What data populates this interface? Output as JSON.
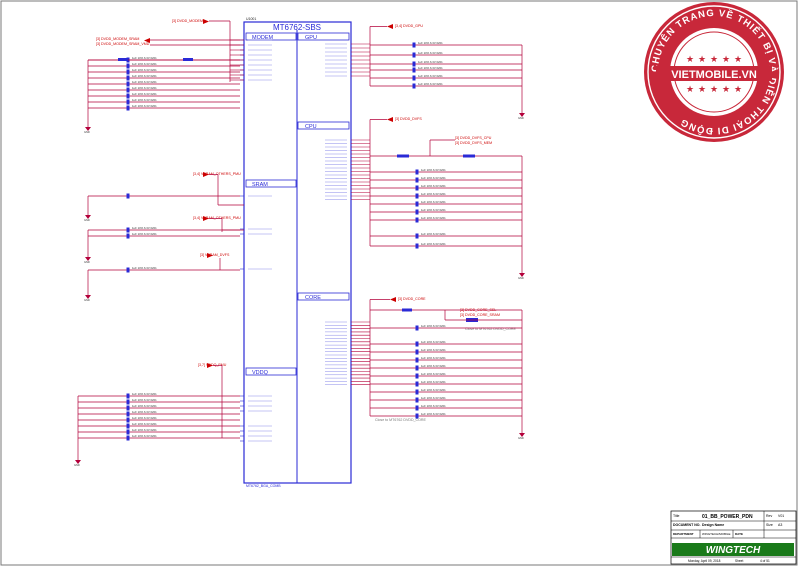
{
  "chip": {
    "title": "MT6762-SBS",
    "ref": "U1001",
    "footer": "MT6762_BGA_COMB",
    "sections": {
      "modem": "MODEM",
      "sram": "SRAM",
      "vddq": "VDDQ",
      "gpu": "GPU",
      "cpu": "CPU",
      "core": "CORE"
    }
  },
  "nets": {
    "modem_top": "[3] DVDD_MODEM",
    "modem_sub1": "[3] DVDD_MODEM_SRAM",
    "modem_sub2": "[3] DVDD_MODEM_SRAM_VMD",
    "sram": "[3,4] VSRAM_OTHERS_PMU",
    "sram_core": "[3,4] VSRAM_OTHERS_PMU",
    "sram_dvfs": "[3] VSRAM_DVFS",
    "vddq": "[3,7] VDDQ_PMU",
    "gpu": "[3,4] DVDD_GPU",
    "cpu": "[3] DVDD_DVFS",
    "core": "[3] DVDD_CORE",
    "core_sub1": "[3] DVDD_CORE_SEL",
    "core_sub2": "[3] DVDD_CORE_SRAM",
    "cpu_sub1": "[3] DVDD_DVFS_CPU",
    "cpu_sub2": "[3] DVDD_DVFS_MEM"
  },
  "parts": {
    "cap_value": "1uF 10% 6.3V 0201",
    "cap_value_small": "0.1uF 10% 6.3V 0201",
    "note_core": "Close to MT6762 DVDD_CORE",
    "gnd": "GND"
  },
  "stamp": {
    "brand": "VIETMOBILE.VN",
    "ring_text": "CHUYÊN TRANG VỀ THIẾT BỊ VÀ DIỄN THOẠI DI ĐỘNG"
  },
  "title_block": {
    "title_label": "Title",
    "title": "01_BB_POWER_PDN",
    "rev_label": "Rev",
    "rev": "V01",
    "doc_label": "DOCUMENT NO.",
    "doc": "Design Name",
    "size_label": "Size",
    "size": "A3",
    "dept_label": "DEPARTMENT",
    "dept": "WINGTECH/MOBILE",
    "date_label": "DATE",
    "date": "Monday, April 09, 2018",
    "sheet_label": "Sheet",
    "sheet": "4 of 51",
    "logo": "WINGTECH"
  }
}
